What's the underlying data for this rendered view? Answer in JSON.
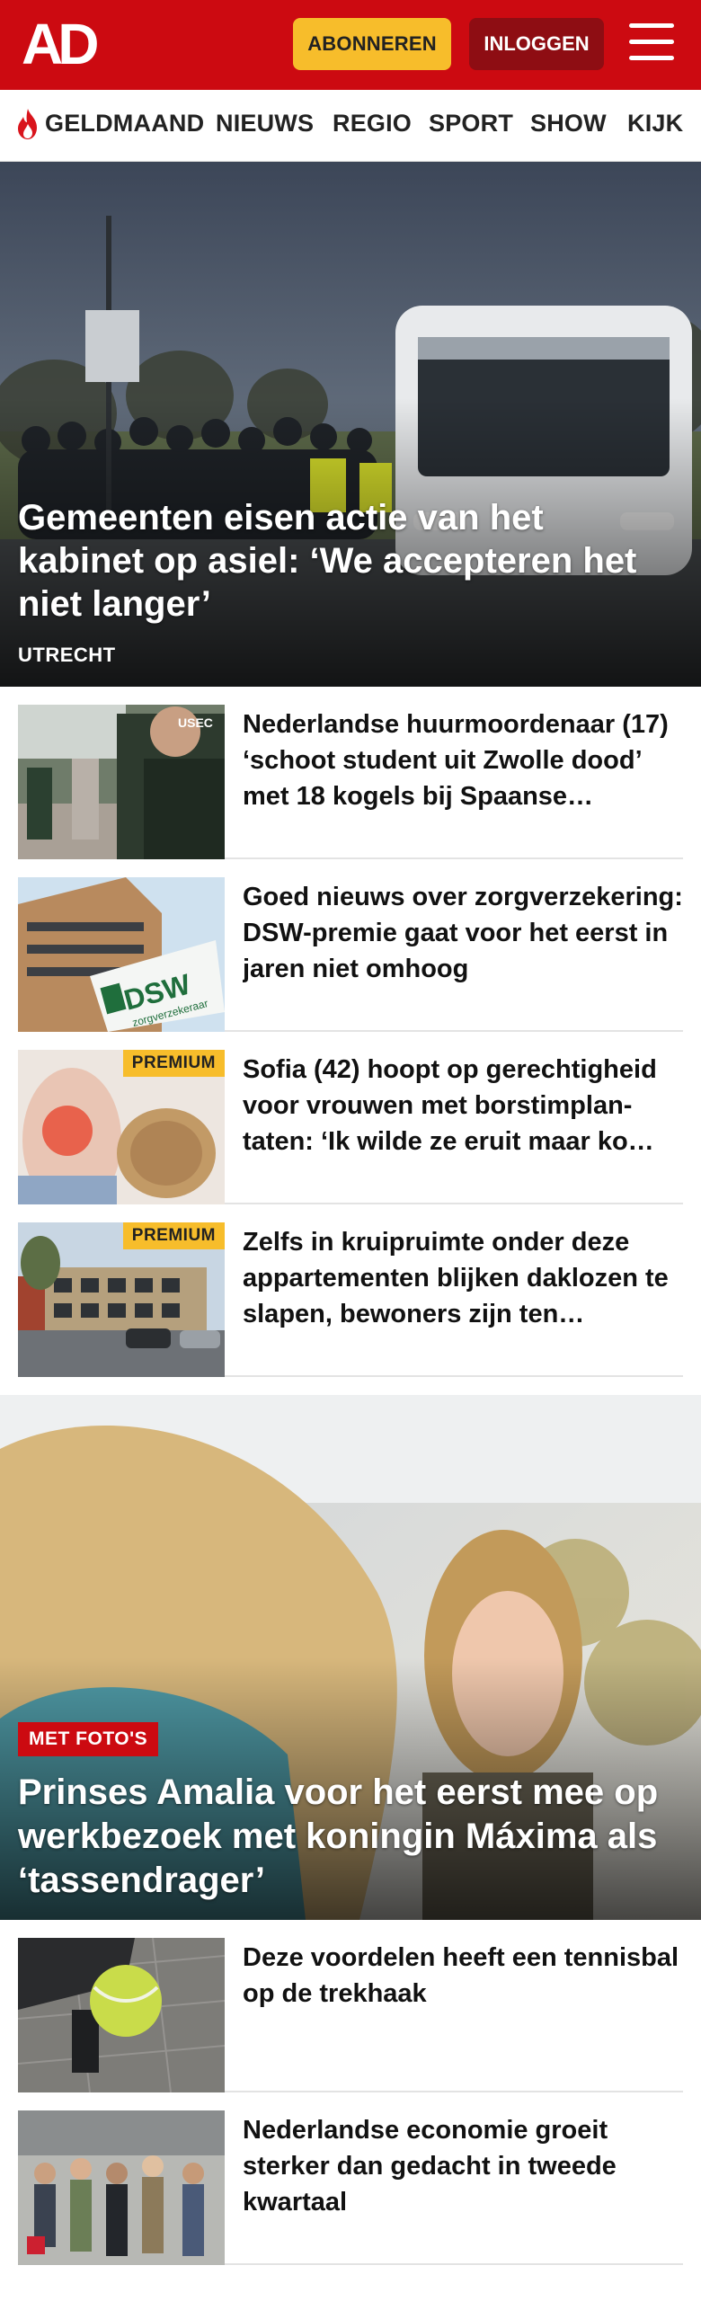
{
  "header": {
    "logo_text": "AD",
    "subscribe_label": "ABONNEREN",
    "login_label": "INLOGGEN",
    "brand_color": "#cc0a11",
    "subscribe_color": "#f7bd2b",
    "login_color": "#8e0d13"
  },
  "nav": {
    "items": [
      "GELDMAAND",
      "NIEUWS",
      "REGIO",
      "SPORT",
      "SHOW",
      "KIJK"
    ],
    "first_icon": "flame-icon"
  },
  "hero": {
    "title": "Gemeenten eisen actie van het kabinet op asiel: ‘We accepteren het niet langer’",
    "location": "UTRECHT"
  },
  "articles_top": [
    {
      "title": "Nederlandse huurmoordenaar (17) ‘schoot student uit Zwolle dood’ met 18 kogels bij Spaanse…",
      "premium": ""
    },
    {
      "title": "Goed nieuws over zorgverzeke­ring: DSW-premie gaat voor het eerst in jaren niet omhoog",
      "premium": ""
    },
    {
      "title": "Sofia (42) hoopt op gerechtigheid voor vrouwen met borstimplan­taten: ‘Ik wilde ze eruit maar ko…",
      "premium": "PREMIUM"
    },
    {
      "title": "Zelfs in kruipruimte onder deze appartementen blijken daklozen te slapen, bewoners zijn ten…",
      "premium": "PREMIUM"
    }
  ],
  "feature": {
    "badge": "MET FOTO'S",
    "title": "Prinses Amalia voor het eerst mee op werkbezoek met koningin Máxima als ‘tassendrager’"
  },
  "articles_bottom": [
    {
      "title": "Deze voordelen heeft een tennisbal op de trekhaak"
    },
    {
      "title": "Nederlandse economie groeit sterker dan gedacht in tweede kwartaal"
    }
  ]
}
